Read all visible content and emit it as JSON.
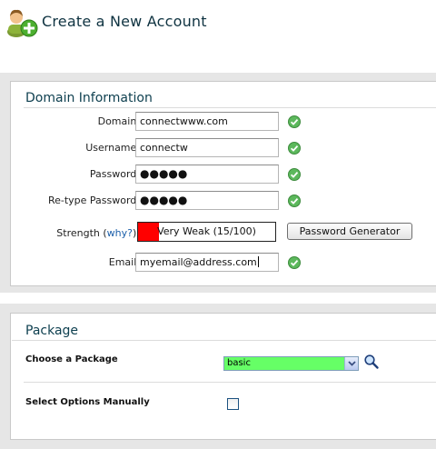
{
  "header": {
    "title": "Create a New Account",
    "icon": "add-user-icon"
  },
  "domain_section": {
    "title": "Domain Information",
    "fields": {
      "domain": {
        "label": "Domain:",
        "value": "connectwww.com"
      },
      "username": {
        "label": "Username:",
        "value": "connectw"
      },
      "password": {
        "label": "Password:",
        "value": "●●●●●"
      },
      "retype": {
        "label": "Re-type Password:",
        "value": "●●●●●"
      },
      "email": {
        "label": "Email:",
        "value": "myemail@address.com"
      }
    },
    "strength": {
      "label_before": "Strength (",
      "why_link": "why?",
      "label_after": "):",
      "text": "Very Weak (15/100)",
      "score_percent": 15,
      "bar_color": "#ff0000"
    },
    "password_generator_button": "Password Generator",
    "valid_icon": "green-check-icon",
    "valid_color": "#5cb85c"
  },
  "package_section": {
    "title": "Package",
    "choose_label": "Choose a Package",
    "selected_package": "basic",
    "select_bg_color": "#66ff66",
    "manual_options_label": "Select Options Manually",
    "manual_options_checked": false,
    "lookup_icon": "magnifier-icon"
  }
}
